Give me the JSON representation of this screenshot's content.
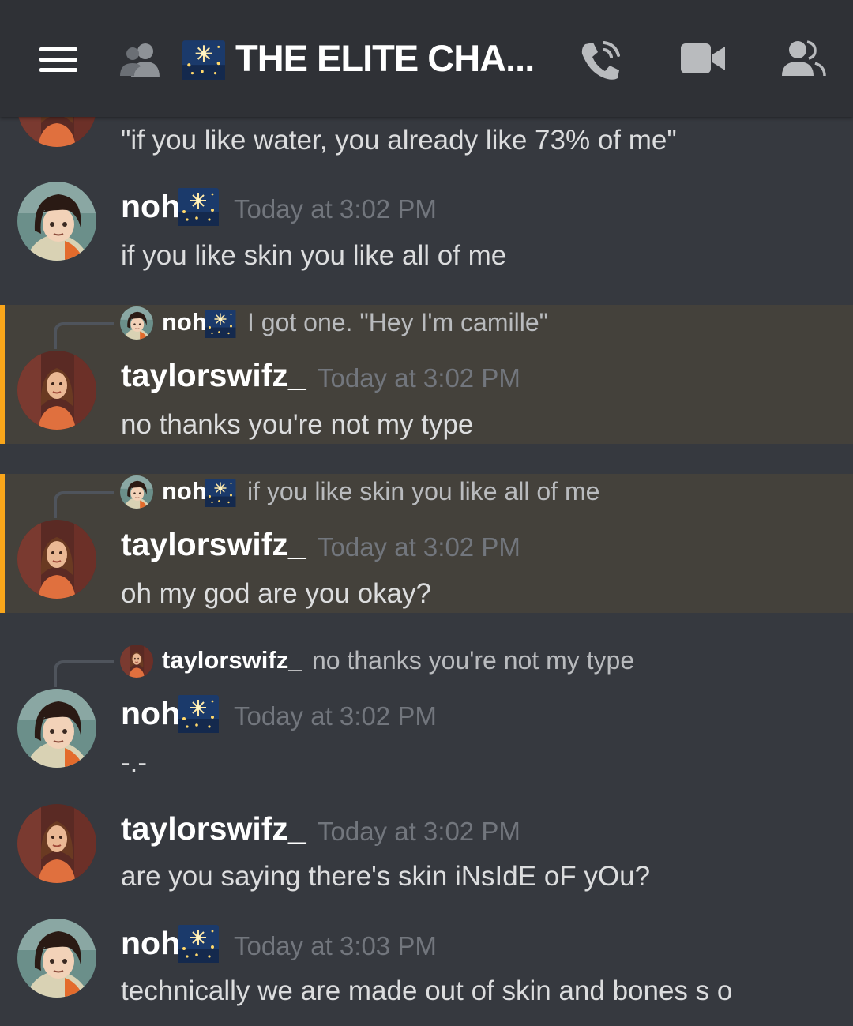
{
  "header": {
    "menu_icon": "hamburger-menu-icon",
    "members_icon": "members-icon",
    "channel_emoji": "fireworks-emoji",
    "channel_title": "THE ELITE CHA...",
    "call_icon": "phone-call-icon",
    "video_icon": "video-camera-icon",
    "member_list_icon": "member-list-icon"
  },
  "messages": [
    {
      "text": "\"if you like water, you already like 73% of me\""
    },
    {
      "author": "noh",
      "timestamp": "Today at 3:02 PM",
      "text": "if you like skin you like all of me"
    },
    {
      "reply": {
        "author": "noh",
        "text": "I got one. \"Hey I'm camille\""
      },
      "author": "taylorswifz_",
      "timestamp": "Today at 3:02 PM",
      "text": "no thanks you're not my type"
    },
    {
      "reply": {
        "author": "noh",
        "text": "if you like skin you like all of me"
      },
      "author": "taylorswifz_",
      "timestamp": "Today at 3:02 PM",
      "text": "oh my god are you okay?"
    },
    {
      "reply": {
        "author": "taylorswifz_",
        "text": "no thanks you're not my type"
      },
      "author": "noh",
      "timestamp": "Today at 3:02 PM",
      "text": "-.-"
    },
    {
      "author": "taylorswifz_",
      "timestamp": "Today at 3:02 PM",
      "text": "are you saying there's skin iNsIdE oF yOu?"
    },
    {
      "author": "noh",
      "timestamp": "Today at 3:03 PM",
      "text": "technically we are made out of skin and bones s o"
    }
  ],
  "colors": {
    "background": "#36393f",
    "header": "#2f3136",
    "highlight": "#44413b",
    "mention_bar": "#faa61a",
    "timestamp": "#72767d"
  }
}
